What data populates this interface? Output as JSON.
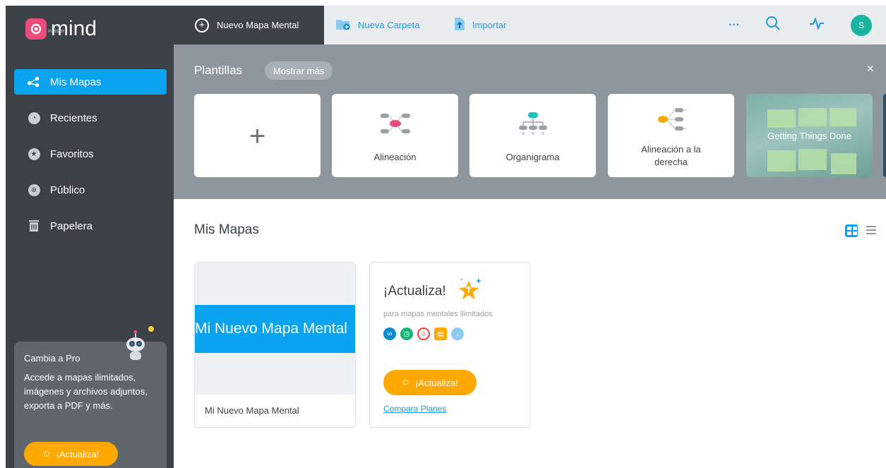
{
  "brand": {
    "name": "mind",
    "sub": "meister",
    "color": "#ec4c7b"
  },
  "sidebar": {
    "items": [
      {
        "label": "Mis Mapas",
        "icon": "mindmap-icon",
        "active": true
      },
      {
        "label": "Recientes",
        "icon": "clock-icon"
      },
      {
        "label": "Favoritos",
        "icon": "star-icon"
      },
      {
        "label": "Público",
        "icon": "globe-icon"
      },
      {
        "label": "Papelera",
        "icon": "trash-icon"
      }
    ],
    "promo": {
      "title": "Cambia a Pro",
      "body": "Accede a mapas ilimitados, imágenes y archivos adjuntos, exporta a PDF y más.",
      "button": "¡Actualiza!"
    }
  },
  "toolbar": {
    "new_map": "Nuevo Mapa Mental",
    "new_folder": "Nueva Carpeta",
    "import": "Importar",
    "more": "···",
    "avatar": "S"
  },
  "templates": {
    "title": "Plantillas",
    "show_more": "Mostrar más",
    "close": "×",
    "cards": [
      {
        "label": "",
        "icon": "plus-icon"
      },
      {
        "label": "Alineación",
        "icon": "alignment-map-icon"
      },
      {
        "label": "Organigrama",
        "icon": "org-chart-icon"
      },
      {
        "label": "Alineación a la derecha",
        "icon": "right-alignment-icon"
      },
      {
        "label": "Getting Things Done",
        "icon": "photo"
      }
    ]
  },
  "main": {
    "title": "Mis Mapas",
    "maps": [
      {
        "preview": "Mi Nuevo Mapa Mental",
        "name": "Mi Nuevo Mapa Mental"
      }
    ],
    "upgrade": {
      "title": "¡Actualiza!",
      "subtitle": "para mapas mentales ilimitados",
      "button": "¡Actualiza!",
      "link": "Compara Planes"
    }
  },
  "colors": {
    "accent": "#0aa3ef",
    "sidebar": "#3b4147",
    "cta": "#ffa800",
    "avatar": "#19b5a0"
  }
}
